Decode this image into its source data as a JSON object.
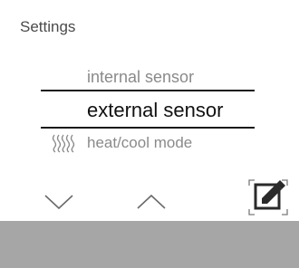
{
  "header": {
    "title": "Settings"
  },
  "menu": {
    "items": [
      {
        "label": "internal sensor",
        "selected": false
      },
      {
        "label": "external sensor",
        "selected": true
      },
      {
        "label": "heat/cool mode",
        "selected": false,
        "icon": "heat-wave-icon"
      }
    ]
  },
  "controls": {
    "down_icon": "chevron-down-icon",
    "up_icon": "chevron-up-icon",
    "edit_icon": "edit-confirm-icon"
  },
  "colors": {
    "background": "#ffffff",
    "text_primary": "#111111",
    "text_secondary": "#8a8a8a",
    "footer": "#a6a6a6"
  }
}
